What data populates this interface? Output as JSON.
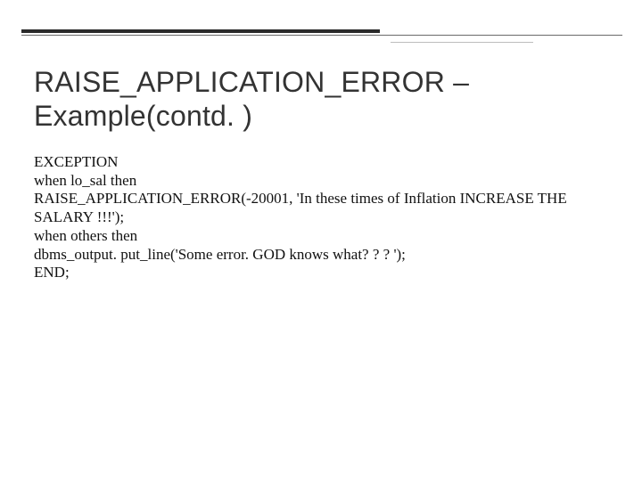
{
  "title": "RAISE_APPLICATION_ERROR – Example(contd. )",
  "body_lines": [
    "EXCEPTION",
    "when lo_sal then",
    "RAISE_APPLICATION_ERROR(-20001, 'In these times of Inflation INCREASE THE  SALARY !!!');",
    "when others then",
    "dbms_output. put_line('Some error. GOD knows what? ? ? ');",
    "END;"
  ]
}
